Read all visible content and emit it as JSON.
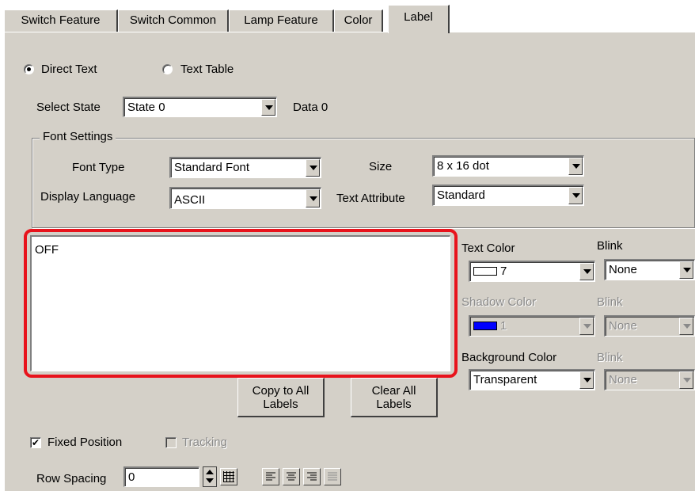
{
  "tabs": [
    {
      "label": "Switch Feature"
    },
    {
      "label": "Switch Common"
    },
    {
      "label": "Lamp Feature"
    },
    {
      "label": "Color"
    },
    {
      "label": "Label"
    }
  ],
  "text_source": {
    "direct_text": "Direct Text",
    "text_table": "Text Table",
    "selected": "Direct Text"
  },
  "state": {
    "label": "Select State",
    "value": "State 0",
    "data_label": "Data 0"
  },
  "font_settings": {
    "title": "Font Settings",
    "font_type_label": "Font Type",
    "font_type_value": "Standard Font",
    "size_label": "Size",
    "size_value": "8 x 16 dot",
    "display_language_label": "Display Language",
    "display_language_value": "ASCII",
    "text_attribute_label": "Text Attribute",
    "text_attribute_value": "Standard"
  },
  "label_text": "OFF",
  "colors": {
    "text_color_label": "Text Color",
    "text_color_value": "7",
    "text_color_swatch": "#ffffff",
    "blink_label": "Blink",
    "text_blink_value": "None",
    "shadow_color_label": "Shadow Color",
    "shadow_color_value": "1",
    "shadow_color_swatch": "#0000ff",
    "shadow_blink_value": "None",
    "background_color_label": "Background Color",
    "background_color_value": "Transparent",
    "background_blink_value": "None"
  },
  "buttons": {
    "copy_line1": "Copy to All",
    "copy_line2": "Labels",
    "clear_line1": "Clear All",
    "clear_line2": "Labels"
  },
  "options": {
    "fixed_position": "Fixed Position",
    "fixed_position_checked": true,
    "tracking": "Tracking",
    "tracking_checked": false
  },
  "row_spacing": {
    "label": "Row Spacing",
    "value": "0"
  },
  "highlight_color": "#e8131c"
}
